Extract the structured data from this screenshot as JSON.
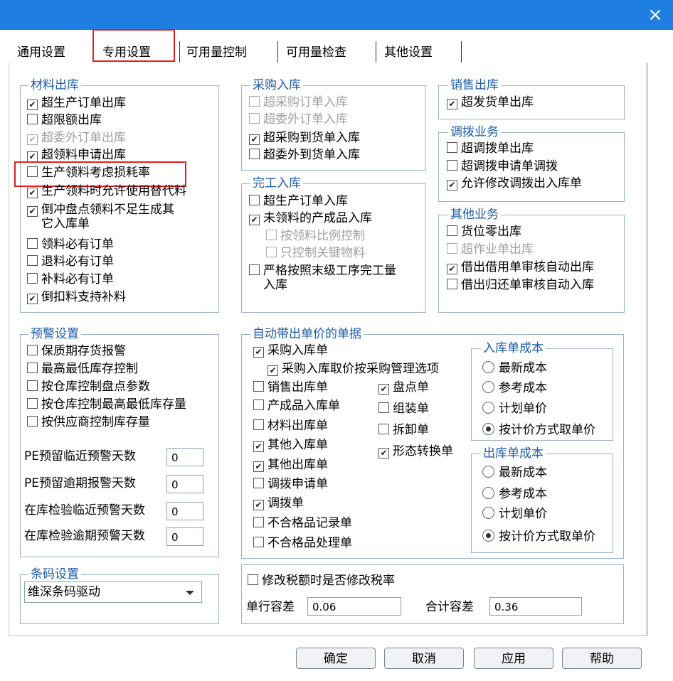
{
  "tabs": [
    {
      "label": "通用设置"
    },
    {
      "label": "专用设置"
    },
    {
      "label": "可用量控制"
    },
    {
      "label": "可用量检查"
    },
    {
      "label": "其他设置"
    }
  ],
  "close_glyph": "×",
  "materials_out": {
    "title": "材料出库",
    "items": [
      {
        "label": "超生产订单出库",
        "checked": true,
        "disabled": false
      },
      {
        "label": "超限额出库",
        "checked": false,
        "disabled": false
      },
      {
        "label": "超委外订单出库",
        "checked": true,
        "disabled": true
      },
      {
        "label": "超领料申请出库",
        "checked": true,
        "disabled": false
      },
      {
        "label": "生产领料考虑损耗率",
        "checked": false,
        "disabled": false
      },
      {
        "label": "生产领料时允许使用替代料",
        "checked": true,
        "disabled": false
      },
      {
        "label": "倒冲盘点领料不足生成其",
        "label2": "它入库单",
        "checked": true,
        "disabled": false
      },
      {
        "label": "领料必有订单",
        "checked": false,
        "disabled": false
      },
      {
        "label": "退料必有订单",
        "checked": false,
        "disabled": false
      },
      {
        "label": "补料必有订单",
        "checked": false,
        "disabled": false
      },
      {
        "label": "倒扣料支持补料",
        "checked": true,
        "disabled": false
      }
    ]
  },
  "purchase_in": {
    "title": "采购入库",
    "items": [
      {
        "label": "超采购订单入库",
        "checked": false,
        "disabled": true
      },
      {
        "label": "超委外订单入库",
        "checked": false,
        "disabled": true
      },
      {
        "label": "超采购到货单入库",
        "checked": true,
        "disabled": false
      },
      {
        "label": "超委外到货单入库",
        "checked": false,
        "disabled": false
      }
    ]
  },
  "complete_in": {
    "title": "完工入库",
    "items": [
      {
        "label": "超生产订单入库",
        "checked": false,
        "disabled": false
      },
      {
        "label": "未领料的产成品入库",
        "checked": true,
        "disabled": false
      },
      {
        "label": "按领料比例控制",
        "checked": false,
        "disabled": true
      },
      {
        "label": "只控制关键物料",
        "checked": false,
        "disabled": true
      },
      {
        "label": "严格按照末级工序完工量",
        "label2": "入库",
        "checked": false,
        "disabled": false
      }
    ]
  },
  "sales_out": {
    "title": "销售出库",
    "items": [
      {
        "label": "超发货单出库",
        "checked": true,
        "disabled": false
      }
    ]
  },
  "transfer": {
    "title": "调拨业务",
    "items": [
      {
        "label": "超调拨单出库",
        "checked": false,
        "disabled": false
      },
      {
        "label": "超调拨申请单调拨",
        "checked": false,
        "disabled": false
      },
      {
        "label": "允许修改调拨出入库单",
        "checked": true,
        "disabled": false
      }
    ]
  },
  "other_biz": {
    "title": "其他业务",
    "items": [
      {
        "label": "货位零出库",
        "checked": false,
        "disabled": false
      },
      {
        "label": "超作业单出库",
        "checked": false,
        "disabled": true
      },
      {
        "label": "借出借用单审核自动出库",
        "checked": true,
        "disabled": false
      },
      {
        "label": "借出归还单审核自动入库",
        "checked": false,
        "disabled": false
      }
    ]
  },
  "warning": {
    "title": "预警设置",
    "items": [
      {
        "label": "保质期存货报警",
        "checked": false
      },
      {
        "label": "最高最低库存控制",
        "checked": false
      },
      {
        "label": "按仓库控制盘点参数",
        "checked": false
      },
      {
        "label": "按仓库控制最高最低库存量",
        "checked": false
      },
      {
        "label": "按供应商控制库存量",
        "checked": false
      }
    ],
    "fields": [
      {
        "label": "PE预留临近预警天数",
        "value": "0"
      },
      {
        "label": "PE预留逾期报警天数",
        "value": "0"
      },
      {
        "label": "在库检验临近预警天数",
        "value": "0"
      },
      {
        "label": "在库检验逾期预警天数",
        "value": "0"
      }
    ]
  },
  "barcode": {
    "title": "条码设置",
    "selected": "维深条码驱动"
  },
  "auto_price": {
    "title": "自动带出单价的单据",
    "purchase": {
      "label": "采购入库单",
      "checked": true
    },
    "purchase_sub": {
      "label": "采购入库取价按采购管理选项",
      "checked": true
    },
    "left": [
      {
        "label": "销售出库单",
        "checked": false
      },
      {
        "label": "产成品入库单",
        "checked": false
      },
      {
        "label": "材料出库单",
        "checked": false
      },
      {
        "label": "其他入库单",
        "checked": true
      },
      {
        "label": "其他出库单",
        "checked": true
      },
      {
        "label": "调拨申请单",
        "checked": false
      },
      {
        "label": "调拨单",
        "checked": true
      },
      {
        "label": "不合格品记录单",
        "checked": false
      },
      {
        "label": "不合格品处理单",
        "checked": false
      }
    ],
    "right": [
      {
        "label": "盘点单",
        "checked": true
      },
      {
        "label": "组装单",
        "checked": false
      },
      {
        "label": "拆卸单",
        "checked": false
      },
      {
        "label": "形态转换单",
        "checked": true
      }
    ],
    "in_cost": {
      "title": "入库单成本",
      "options": [
        {
          "label": "最新成本",
          "selected": false
        },
        {
          "label": "参考成本",
          "selected": false
        },
        {
          "label": "计划单价",
          "selected": false
        },
        {
          "label": "按计价方式取单价",
          "selected": true
        }
      ]
    },
    "out_cost": {
      "title": "出库单成本",
      "options": [
        {
          "label": "最新成本",
          "selected": false
        },
        {
          "label": "参考成本",
          "selected": false
        },
        {
          "label": "计划单价",
          "selected": false
        },
        {
          "label": "按计价方式取单价",
          "selected": true
        }
      ]
    }
  },
  "tax": {
    "modify_label": "修改税额时是否修改税率",
    "modify_checked": false,
    "row_tol_label": "单行容差",
    "row_tol_value": "0.06",
    "total_tol_label": "合计容差",
    "total_tol_value": "0.36"
  },
  "buttons": {
    "ok": "确定",
    "cancel": "取消",
    "apply": "应用",
    "help": "帮助"
  },
  "colors": {
    "titlebar": "#1f7fe0",
    "group_title": "#1e5aa8",
    "highlight": "#e02020"
  }
}
